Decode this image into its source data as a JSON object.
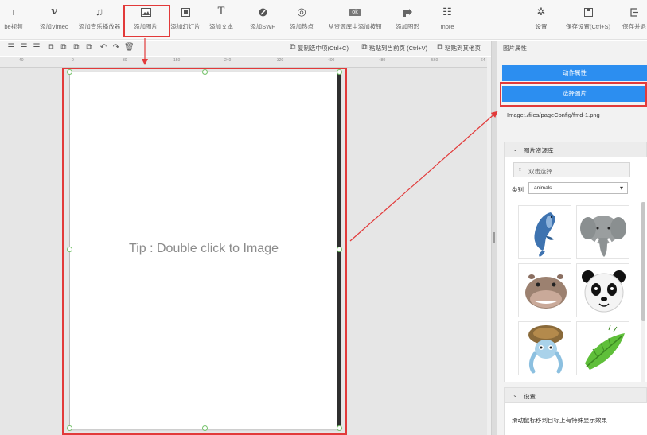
{
  "toolbar": {
    "items": [
      {
        "icon": "youtube-icon",
        "glyph": "▶",
        "label": "be视频"
      },
      {
        "icon": "vimeo-icon",
        "glyph": "v",
        "label": "添加Vimeo"
      },
      {
        "icon": "music-note-icon",
        "glyph": "♫",
        "label": "添加音乐播放器"
      },
      {
        "icon": "image-icon",
        "glyph": "▣",
        "label": "添加图片"
      },
      {
        "icon": "slideshow-icon",
        "glyph": "⧉",
        "label": "添加幻灯片"
      },
      {
        "icon": "text-icon",
        "glyph": "T",
        "label": "添加文本"
      },
      {
        "icon": "swf-icon",
        "glyph": "⊘",
        "label": "添加SWF"
      },
      {
        "icon": "hotspot-icon",
        "glyph": "◎",
        "label": "添加热点"
      },
      {
        "icon": "ok-button-icon",
        "glyph": "ok",
        "label": "从资源库中添加按钮"
      },
      {
        "icon": "chart-icon",
        "glyph": "▰",
        "label": "添加图形"
      },
      {
        "icon": "more-icon",
        "glyph": "☷",
        "label": "more"
      },
      {
        "icon": "gear-icon",
        "glyph": "✲",
        "label": "设置"
      },
      {
        "icon": "save-settings-icon",
        "glyph": "▭",
        "label": "保存设置(Ctrl+S)"
      },
      {
        "icon": "save-exit-icon",
        "glyph": "⇲",
        "label": "保存并退"
      }
    ]
  },
  "toolbar2": {
    "copy_label": "复制选中项(Ctrl+C)",
    "paste_label": "粘贴到当前页 (Ctrl+V)",
    "paste_other_label": "粘贴到其他页"
  },
  "ruler": {
    "labels": [
      "40",
      "0",
      "30",
      "150",
      "240",
      "320",
      "400",
      "480",
      "560",
      "64"
    ]
  },
  "canvas": {
    "tip": "Tip : Double click to Image"
  },
  "panel": {
    "title": "图片属性",
    "action_button": "动作属性",
    "select_button": "选择图片",
    "image_path": "Image:./files/pageConfig/fmd-1.png",
    "library": {
      "title": "图片资源库",
      "dblclick_label": "双击选择",
      "category_label": "类别",
      "category_value": "animals",
      "thumbs": [
        "dolphin",
        "elephant",
        "hippo",
        "panda",
        "turtle",
        "leaf-insect"
      ]
    },
    "settings": {
      "title": "设置",
      "text": "滑动鼠标移到目标上有特殊显示效果"
    }
  },
  "colors": {
    "accent_blue": "#2c8ef0",
    "highlight_red": "#e23a3a",
    "handle_green": "#74c26a"
  }
}
